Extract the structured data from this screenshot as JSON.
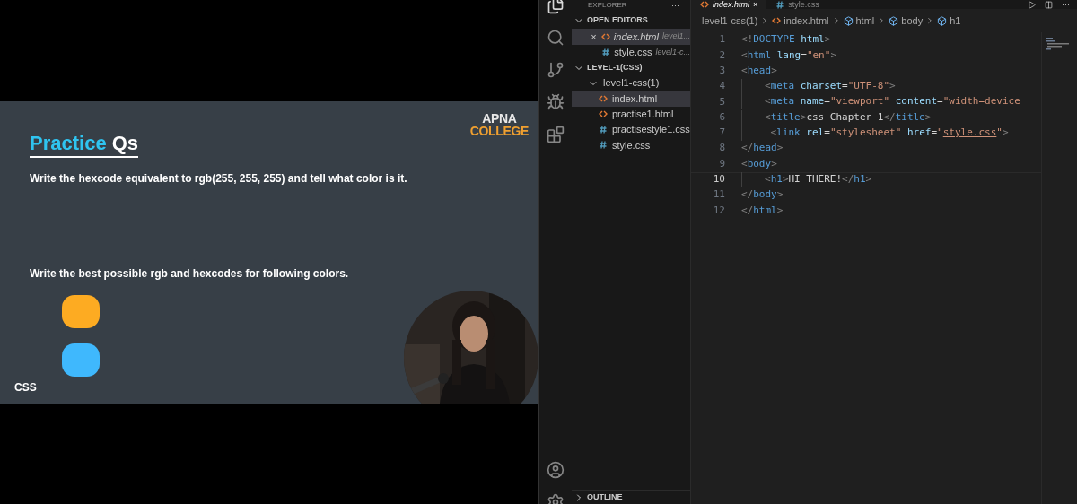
{
  "slide": {
    "logo": [
      "APNA",
      "COLLEGE"
    ],
    "title": [
      {
        "text": "Practice",
        "kind": "accent"
      },
      {
        "text": "Qs",
        "kind": "plain"
      }
    ],
    "question_1": "Write the hexcode equivalent to rgb(255, 255, 255) and tell what color is it.",
    "question_2": "Write the best possible rgb and hexcodes for following colors.",
    "swatches": [
      {
        "color": "#fdab22"
      },
      {
        "color": "#3fb8fd"
      }
    ],
    "footer": "CSS",
    "webcam": {
      "kind": "picture"
    }
  },
  "editor": {
    "sidebar": {
      "title": "EXPLORER",
      "more": "···",
      "open_editors": {
        "label": "OPEN EDITORS",
        "expanded": true,
        "items": [
          {
            "name": "index.html",
            "path": "level1...",
            "kind": "html",
            "selected": true,
            "close": "×"
          },
          {
            "name": "style.css",
            "path": "level1-c...",
            "kind": "css",
            "selected": false
          }
        ]
      },
      "folder": {
        "label": "LEVEL-1(CSS)",
        "expanded": true,
        "children": [
          {
            "name": "level1-css(1)",
            "kind": "folder",
            "expanded": true,
            "children": [
              {
                "name": "index.html",
                "kind": "html",
                "selected": true
              },
              {
                "name": "practise1.html",
                "kind": "html",
                "selected": false
              },
              {
                "name": "practisestyle1.css",
                "kind": "css",
                "selected": false
              },
              {
                "name": "style.css",
                "kind": "css",
                "selected": false
              }
            ]
          }
        ]
      },
      "outline": {
        "label": "OUTLINE",
        "expanded": false
      }
    },
    "tabs": [
      {
        "name": "index.html",
        "kind": "html",
        "selected": true,
        "close": "×"
      },
      {
        "name": "style.css",
        "kind": "css",
        "selected": false
      }
    ],
    "tab_actions": "···",
    "breadcrumb": [
      {
        "text": "level1-css(1)",
        "kind": "folder"
      },
      {
        "text": "index.html",
        "kind": "html"
      },
      {
        "text": "html",
        "kind": "element"
      },
      {
        "text": "body",
        "kind": "element"
      },
      {
        "text": "h1",
        "kind": "element"
      }
    ],
    "lines": [
      {
        "number": "1",
        "active": false,
        "guide": false,
        "tokens": [
          {
            "t": "<!",
            "kind": "punct"
          },
          {
            "t": "DOCTYPE",
            "kind": "tag"
          },
          {
            "t": " html",
            "kind": "attr"
          },
          {
            "t": ">",
            "kind": "punct"
          }
        ]
      },
      {
        "number": "2",
        "active": false,
        "guide": false,
        "tokens": [
          {
            "t": "<",
            "kind": "punct"
          },
          {
            "t": "html",
            "kind": "tag"
          },
          {
            "t": " lang",
            "kind": "attr"
          },
          {
            "t": "=",
            "kind": "text"
          },
          {
            "t": "\"en\"",
            "kind": "string"
          },
          {
            "t": ">",
            "kind": "punct"
          }
        ]
      },
      {
        "number": "3",
        "active": false,
        "guide": false,
        "tokens": [
          {
            "t": "<",
            "kind": "punct"
          },
          {
            "t": "head",
            "kind": "tag"
          },
          {
            "t": ">",
            "kind": "punct"
          }
        ]
      },
      {
        "number": "4",
        "active": false,
        "guide": true,
        "tokens": [
          {
            "t": "<",
            "kind": "punct"
          },
          {
            "t": "meta",
            "kind": "tag"
          },
          {
            "t": " charset",
            "kind": "attr"
          },
          {
            "t": "=",
            "kind": "text"
          },
          {
            "t": "\"UTF-8\"",
            "kind": "string"
          },
          {
            "t": ">",
            "kind": "punct"
          }
        ]
      },
      {
        "number": "5",
        "active": false,
        "guide": true,
        "tokens": [
          {
            "t": "<",
            "kind": "punct"
          },
          {
            "t": "meta",
            "kind": "tag"
          },
          {
            "t": " name",
            "kind": "attr"
          },
          {
            "t": "=",
            "kind": "text"
          },
          {
            "t": "\"viewport\"",
            "kind": "string"
          },
          {
            "t": " content",
            "kind": "attr"
          },
          {
            "t": "=",
            "kind": "text"
          },
          {
            "t": "\"width=device",
            "kind": "string"
          }
        ]
      },
      {
        "number": "6",
        "active": false,
        "guide": true,
        "tokens": [
          {
            "t": "<",
            "kind": "punct"
          },
          {
            "t": "title",
            "kind": "tag"
          },
          {
            "t": ">",
            "kind": "punct"
          },
          {
            "t": "css Chapter 1",
            "kind": "text"
          },
          {
            "t": "</",
            "kind": "punct"
          },
          {
            "t": "title",
            "kind": "tag"
          },
          {
            "t": ">",
            "kind": "punct"
          }
        ]
      },
      {
        "number": "7",
        "active": false,
        "guide": true,
        "tokens": [
          {
            "t": " <",
            "kind": "punct"
          },
          {
            "t": "link",
            "kind": "tag"
          },
          {
            "t": " rel",
            "kind": "attr"
          },
          {
            "t": "=",
            "kind": "text"
          },
          {
            "t": "\"stylesheet\"",
            "kind": "string"
          },
          {
            "t": " href",
            "kind": "attr"
          },
          {
            "t": "=",
            "kind": "text"
          },
          {
            "t": "\"",
            "kind": "string"
          },
          {
            "t": "style.css",
            "kind": "link"
          },
          {
            "t": "\"",
            "kind": "string"
          },
          {
            "t": ">",
            "kind": "punct"
          }
        ]
      },
      {
        "number": "8",
        "active": false,
        "guide": false,
        "tokens": [
          {
            "t": "</",
            "kind": "punct"
          },
          {
            "t": "head",
            "kind": "tag"
          },
          {
            "t": ">",
            "kind": "punct"
          }
        ]
      },
      {
        "number": "9",
        "active": false,
        "guide": false,
        "tokens": [
          {
            "t": "<",
            "kind": "punct"
          },
          {
            "t": "body",
            "kind": "tag"
          },
          {
            "t": ">",
            "kind": "punct"
          }
        ]
      },
      {
        "number": "10",
        "active": true,
        "guide": true,
        "tokens": [
          {
            "t": "<",
            "kind": "punct"
          },
          {
            "t": "h1",
            "kind": "tag"
          },
          {
            "t": ">",
            "kind": "punct"
          },
          {
            "t": "HI THERE!",
            "kind": "text"
          },
          {
            "t": "</",
            "kind": "punct"
          },
          {
            "t": "h1",
            "kind": "tag"
          },
          {
            "t": ">",
            "kind": "punct"
          }
        ]
      },
      {
        "number": "11",
        "active": false,
        "guide": false,
        "tokens": [
          {
            "t": "</",
            "kind": "punct"
          },
          {
            "t": "body",
            "kind": "tag"
          },
          {
            "t": ">",
            "kind": "punct"
          }
        ]
      },
      {
        "number": "12",
        "active": false,
        "guide": false,
        "tokens": [
          {
            "t": "</",
            "kind": "punct"
          },
          {
            "t": "html",
            "kind": "tag"
          },
          {
            "t": ">",
            "kind": "punct"
          }
        ]
      }
    ]
  }
}
